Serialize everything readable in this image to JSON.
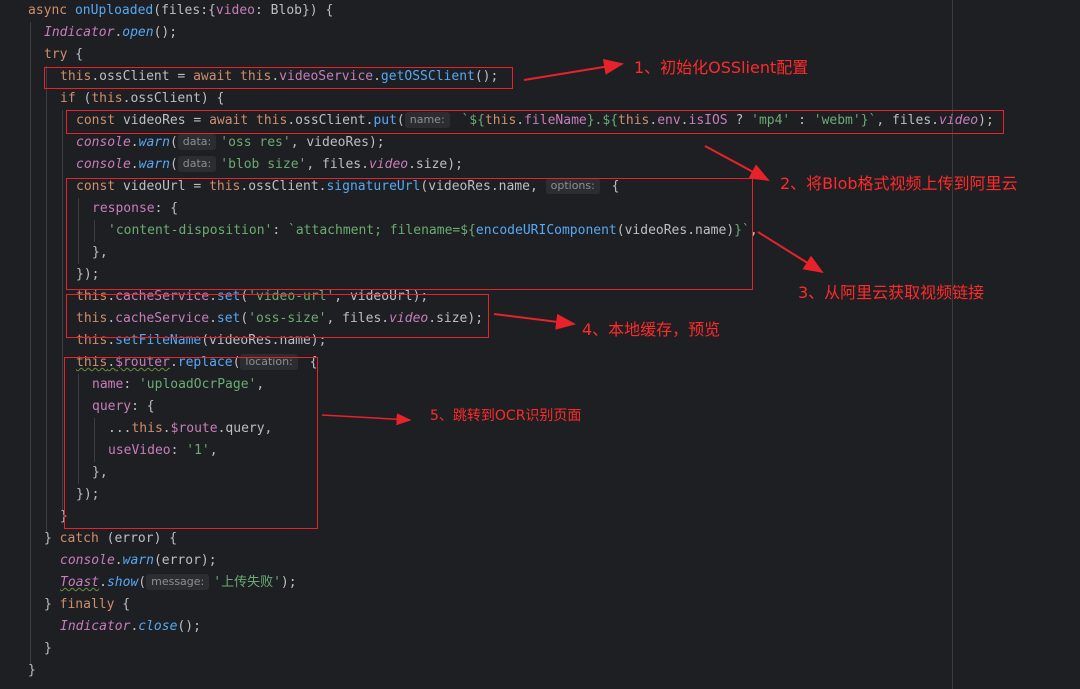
{
  "colors": {
    "background": "#1e1f22",
    "keyword": "#cf8e6d",
    "function": "#56a8f5",
    "property": "#c77dbb",
    "string": "#6aab73",
    "text": "#bcbec4",
    "annotation": "#ff2a2a"
  },
  "code": {
    "l1": {
      "async": "async ",
      "fn": "onUploaded",
      "rest1": "(files:{",
      "prop": "video",
      "rest2": ": Blob}) {"
    },
    "l2": {
      "obj": "Indicator",
      "dot": ".",
      "fn": "open",
      "rest": "();"
    },
    "l3": {
      "kw": "try",
      "rest": " {"
    },
    "l4": {
      "this": "this",
      "p1": ".ossClient = ",
      "await": "await ",
      "this2": "this",
      "dot": ".",
      "prop": "videoService",
      "dot2": ".",
      "fn": "getOSSClient",
      "rest": "();"
    },
    "l5": {
      "kw": "if",
      "p1": " (",
      "this": "this",
      "rest": ".ossClient) {"
    },
    "l6": {
      "const": "const ",
      "p1": "videoRes = ",
      "await": "await ",
      "this": "this",
      "p2": ".ossClient.",
      "fn": "put",
      "p3": "(",
      "hint": "name:",
      "s1": " `${",
      "this2": "this",
      "dot": ".",
      "prop": "fileName",
      "s2": "}.${",
      "this3": "this",
      "dot2": ".",
      "prop2": "env",
      "dot3": ".",
      "prop3": "isIOS",
      "p4": " ? ",
      "str1": "'mp4'",
      "p5": " : ",
      "str2": "'webm'",
      "s3": "}`",
      "p6": ", files.",
      "prop4": "video",
      "rest": ");"
    },
    "l7": {
      "obj": "console",
      "dot": ".",
      "fn": "warn",
      "p1": "(",
      "hint": "data:",
      "str": "'oss res'",
      "rest": ", videoRes);"
    },
    "l8": {
      "obj": "console",
      "dot": ".",
      "fn": "warn",
      "p1": "(",
      "hint": "data:",
      "str": "'blob size'",
      "p2": ", files.",
      "prop": "video",
      "rest": ".size);"
    },
    "l9": {
      "const": "const ",
      "p1": "videoUrl = ",
      "this": "this",
      "p2": ".ossClient.",
      "fn": "signatureUrl",
      "p3": "(videoRes.name, ",
      "hint": "options:",
      "rest": " {"
    },
    "l10": {
      "prop": "response",
      "rest": ": {"
    },
    "l11": {
      "str1": "'content-disposition'",
      "p1": ": ",
      "str2": "`attachment; filename=${",
      "fn": "encodeURIComponent",
      "p2": "(videoRes.name)",
      "str3": "}`",
      "rest": ","
    },
    "l12": {
      "text": "},"
    },
    "l13": {
      "text": "});"
    },
    "l14": {
      "this": "this",
      "dot": ".",
      "prop": "cacheService",
      "dot2": ".",
      "fn": "set",
      "p1": "(",
      "str": "'video-url'",
      "rest": ", videoUrl);"
    },
    "l15": {
      "this": "this",
      "dot": ".",
      "prop": "cacheService",
      "dot2": ".",
      "fn": "set",
      "p1": "(",
      "str": "'oss-size'",
      "p2": ", files.",
      "prop2": "video",
      "rest": ".size);"
    },
    "l16": {
      "this": "this",
      "dot": ".",
      "fn": "setFileName",
      "rest": "(videoRes.name);"
    },
    "l17": {
      "this": "this",
      "dot": ".",
      "prop": "$router",
      "dot2": ".",
      "fn": "replace",
      "p1": "(",
      "hint": "location:",
      "rest": " {"
    },
    "l18": {
      "prop": "name",
      "p1": ": ",
      "str": "'uploadOcrPage'",
      "rest": ","
    },
    "l19": {
      "prop": "query",
      "rest": ": {"
    },
    "l20": {
      "p1": "...",
      "this": "this",
      "dot": ".",
      "prop": "$route",
      "rest": ".query,"
    },
    "l21": {
      "prop": "useVideo",
      "p1": ": ",
      "str": "'1'",
      "rest": ","
    },
    "l22": {
      "text": "},"
    },
    "l23": {
      "text": "});"
    },
    "l24": {
      "text": "}"
    },
    "l25": {
      "p1": "} ",
      "kw": "catch",
      "rest": " (error) {"
    },
    "l26": {
      "obj": "console",
      "dot": ".",
      "fn": "warn",
      "rest": "(error);"
    },
    "l27": {
      "obj": "Toast",
      "dot": ".",
      "fn": "show",
      "p1": "(",
      "hint": "message:",
      "str": "'上传失败'",
      "rest": ");"
    },
    "l28": {
      "p1": "} ",
      "kw": "finally",
      "rest": " {"
    },
    "l29": {
      "obj": "Indicator",
      "dot": ".",
      "fn": "close",
      "rest": "();"
    },
    "l30": {
      "text": "}"
    },
    "l31": {
      "text": "}"
    }
  },
  "annotations": {
    "a1": "1、初始化OSSlient配置",
    "a2": "2、将Blob格式视频上传到阿里云",
    "a3": "3、从阿里云获取视频链接",
    "a4": "4、本地缓存，预览",
    "a5": "5、跳转到OCR识别页面"
  }
}
